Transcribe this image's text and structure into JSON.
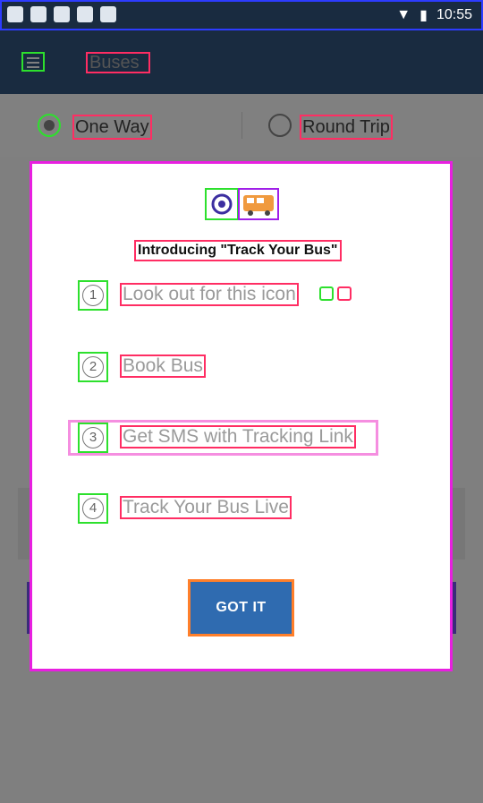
{
  "status_bar": {
    "time": "10:55",
    "icons": [
      "notification-icon",
      "whatsapp-icon",
      "gallery-icon",
      "esc-icon",
      "pinterest-icon",
      "wifi-icon",
      "battery-icon"
    ]
  },
  "app": {
    "title": "Buses"
  },
  "trip_type": {
    "one_way": "One Way",
    "round_trip": "Round Trip",
    "selected": "One Way"
  },
  "modal": {
    "title": "Introducing \"Track Your Bus\"",
    "steps": [
      {
        "number": "1",
        "text": "Look out for this icon"
      },
      {
        "number": "2",
        "text": "Book Bus"
      },
      {
        "number": "3",
        "text": "Get SMS with Tracking Link"
      },
      {
        "number": "4",
        "text": "Track Your Bus Live"
      }
    ],
    "button": "GOT IT"
  },
  "colors": {
    "appbar": "#192b40",
    "overlay": "#808080",
    "button": "#2f6bb0"
  }
}
